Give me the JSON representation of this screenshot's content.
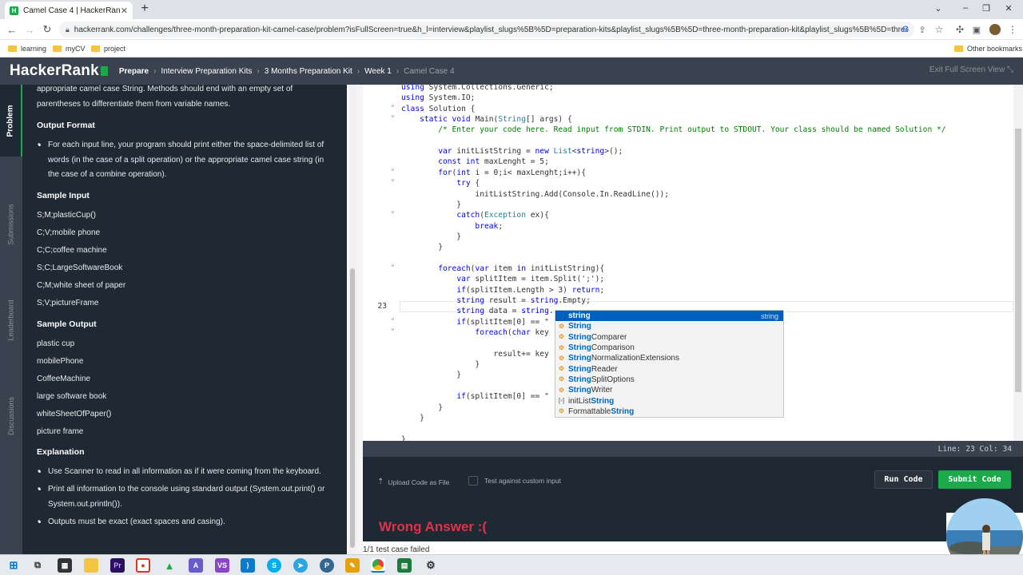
{
  "browser": {
    "tab_title": "Camel Case 4 | HackerRank",
    "tab_close": "✕",
    "new_tab": "+",
    "url": "hackerrank.com/challenges/three-month-preparation-kit-camel-case/problem?isFullScreen=true&h_l=interview&playlist_slugs%5B%5D=preparation-kits&playlist_slugs%5B%5D=three-month-preparation-kit&playlist_slugs%5B%5D=three-month-...",
    "bookmarks": [
      "learning",
      "myCV",
      "project"
    ],
    "other_bookmarks": "Other bookmarks"
  },
  "header": {
    "logo": "HackerRank",
    "breadcrumbs": [
      "Prepare",
      "Interview Preparation Kits",
      "3 Months Preparation Kit",
      "Week 1",
      "Camel Case 4"
    ],
    "exit_fullscreen": "Exit Full Screen View"
  },
  "side_tabs": [
    "Problem",
    "Submissions",
    "Leaderboard",
    "Discussions"
  ],
  "problem": {
    "intro_line1": "appropriate camel case String. Methods should end with an empty set of",
    "intro_line2": "parentheses to differentiate them from variable names.",
    "output_format_heading": "Output Format",
    "output_format_item_l1": "For each input line, your program should print either the space-delimited list of",
    "output_format_item_l2": "words (in the case of a split operation) or the appropriate camel case string (in",
    "output_format_item_l3": "the case of a combine operation).",
    "sample_input_heading": "Sample Input",
    "sample_input": [
      "S;M;plasticCup()",
      "C;V;mobile phone",
      "C;C;coffee machine",
      "S;C;LargeSoftwareBook",
      "C;M;white sheet of paper",
      "S;V;pictureFrame"
    ],
    "sample_output_heading": "Sample Output",
    "sample_output": [
      "plastic cup",
      "mobilePhone",
      "CoffeeMachine",
      "large software book",
      "whiteSheetOfPaper()",
      "picture frame"
    ],
    "explanation_heading": "Explanation",
    "explanation_1": "Use Scanner to read in all information as if it were coming from the keyboard.",
    "explanation_2_l1": "Print all information to the console using standard output (System.out.print() or",
    "explanation_2_l2": "System.out.println()).",
    "explanation_3": "Outputs must be exact (exact spaces and casing)."
  },
  "editor": {
    "current_line_number": "23",
    "lines": [
      "using System.Collections.Generic;",
      "using System.IO;",
      "class Solution {",
      "    static void Main(String[] args) {",
      "        /* Enter your code here. Read input from STDIN. Print output to STDOUT. Your class should be named Solution */",
      "",
      "        var initListString = new List<string>();",
      "        const int maxLenght = 5;",
      "        for(int i = 0;i< maxLenght;i++){",
      "            try {",
      "                initListString.Add(Console.In.ReadLine());",
      "            }",
      "            catch(Exception ex){",
      "                break;",
      "            }",
      "        }",
      "",
      "        foreach(var item in initListString){",
      "            var splitItem = item.Split(';');",
      "            if(splitItem.Length > 3) return;",
      "            string result = string.Empty;",
      "            string data = string.",
      "            if(splitItem[0] == \"",
      "                foreach(char key",
      "",
      "                    result+= key",
      "                }",
      "            }",
      "",
      "            if(splitItem[0] == \"",
      "        }",
      "    }",
      "",
      "}"
    ],
    "status": "Line: 23 Col: 34"
  },
  "autocomplete": {
    "selected_type": "string",
    "items": [
      {
        "match": "string",
        "rest": "",
        "pre": ""
      },
      {
        "match": "String",
        "rest": "",
        "pre": ""
      },
      {
        "match": "String",
        "rest": "Comparer",
        "pre": ""
      },
      {
        "match": "String",
        "rest": "Comparison",
        "pre": ""
      },
      {
        "match": "String",
        "rest": "NormalizationExtensions",
        "pre": ""
      },
      {
        "match": "String",
        "rest": "Reader",
        "pre": ""
      },
      {
        "match": "String",
        "rest": "SplitOptions",
        "pre": ""
      },
      {
        "match": "String",
        "rest": "Writer",
        "pre": ""
      },
      {
        "match": "String",
        "rest": "",
        "pre": "initList"
      },
      {
        "match": "String",
        "rest": "",
        "pre": "Formattable"
      }
    ]
  },
  "actions": {
    "upload": "Upload Code as File",
    "custom_input": "Test against custom input",
    "run": "Run Code",
    "submit": "Submit Code"
  },
  "result": {
    "title": "Wrong Answer :(",
    "subtitle": "1/1 test case failed"
  },
  "colors": {
    "brand_green": "#1ba94c",
    "header_bg": "#39424e",
    "panel_bg": "#1f2933",
    "error_red": "#e0314b"
  }
}
